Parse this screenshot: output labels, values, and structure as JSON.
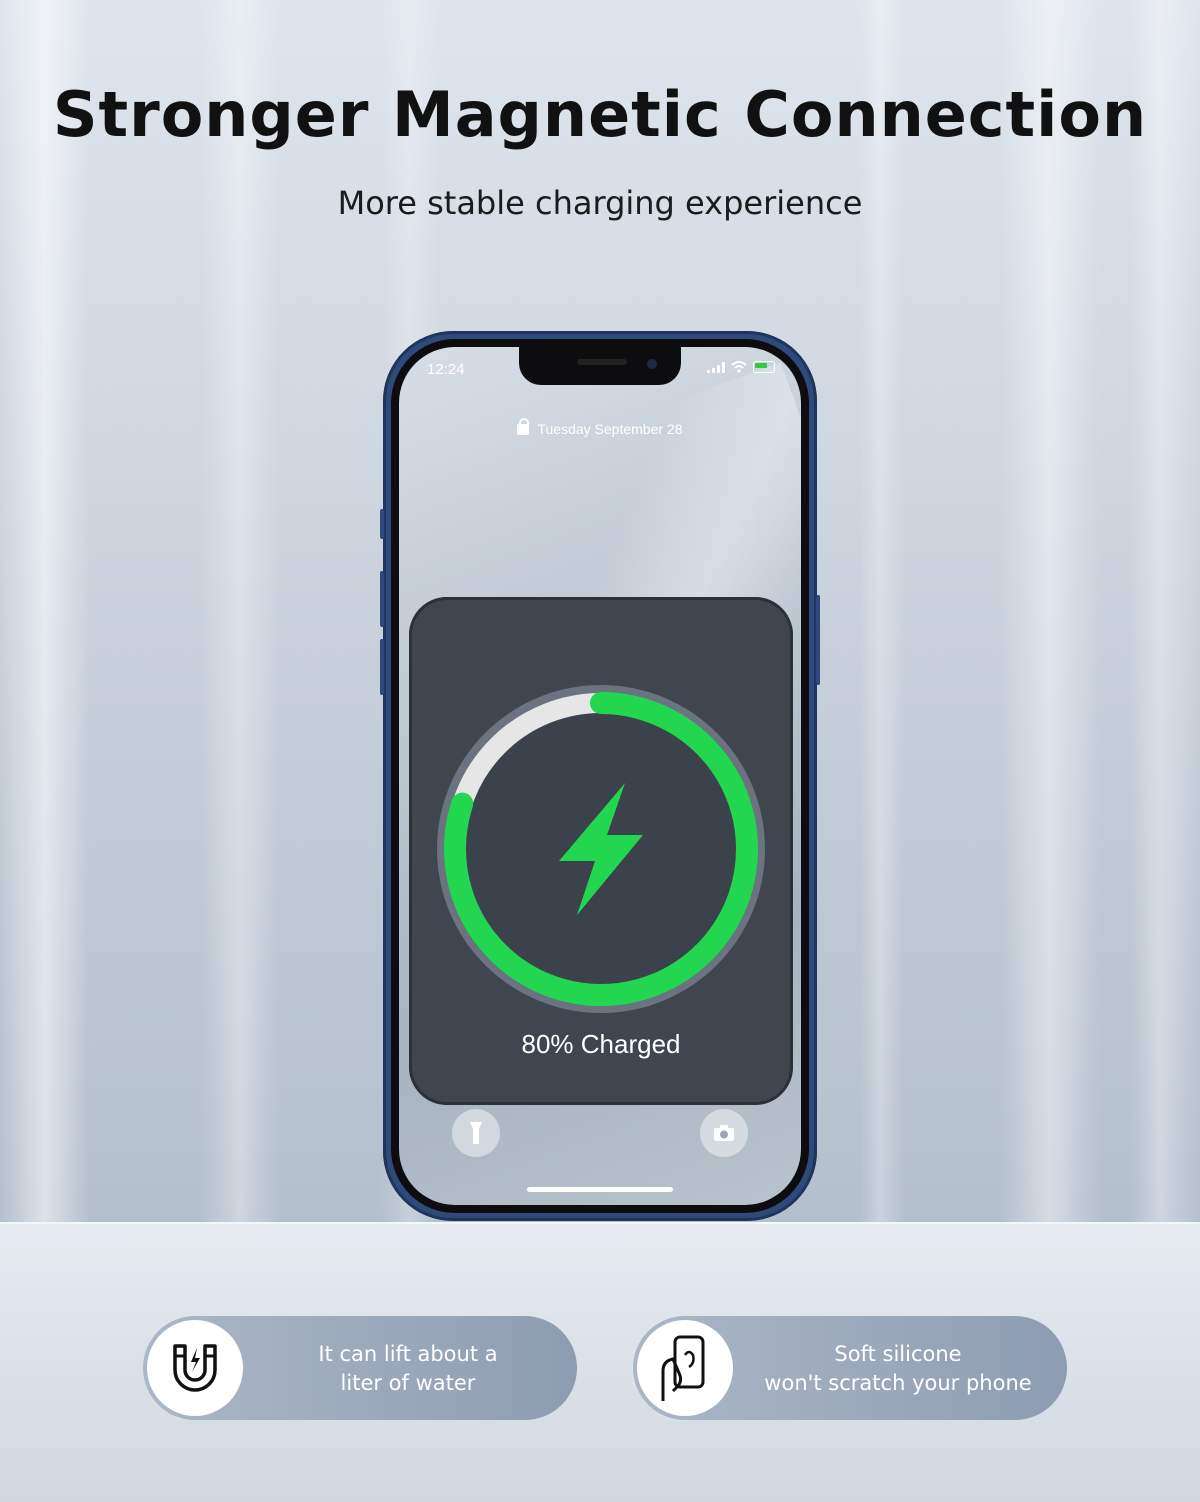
{
  "header": {
    "title": "Stronger Magnetic Connection",
    "subtitle": "More stable charging experience"
  },
  "phone": {
    "status_time": "12:24",
    "lock_date": "Tuesday September 28",
    "charge_label": "80% Charged",
    "charge_progress": 0.8,
    "ring_color": "#22d64f",
    "icons": [
      "lock-icon",
      "signal-icon",
      "wifi-icon",
      "battery-icon",
      "bolt-icon",
      "flashlight-icon",
      "camera-icon"
    ]
  },
  "features": [
    {
      "icon": "magnet-icon",
      "line1": "It can lift about a",
      "line2": "liter of water"
    },
    {
      "icon": "hand-phone-icon",
      "line1": "Soft silicone",
      "line2": "won't scratch your phone"
    }
  ]
}
